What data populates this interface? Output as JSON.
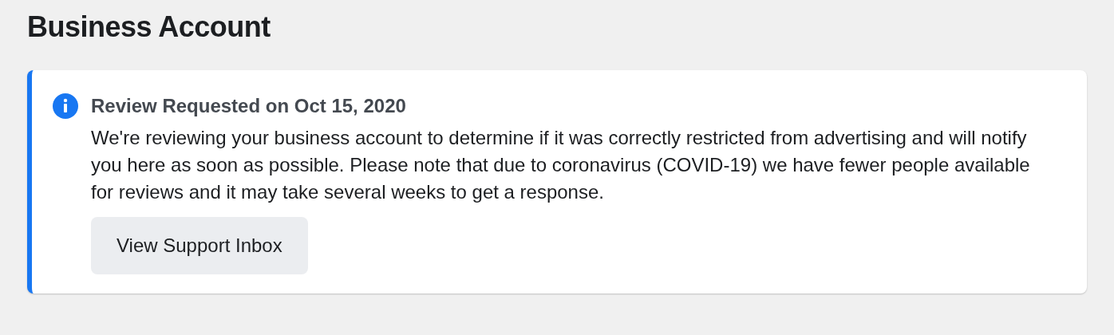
{
  "page_title": "Business Account",
  "notice": {
    "title": "Review Requested on Oct 15, 2020",
    "message": "We're reviewing your business account to determine if it was correctly restricted from advertising and will notify you here as soon as possible. Please note that due to coronavirus (COVID-19) we have fewer people available for reviews and it may take several weeks to get a response.",
    "button": "View Support Inbox"
  }
}
